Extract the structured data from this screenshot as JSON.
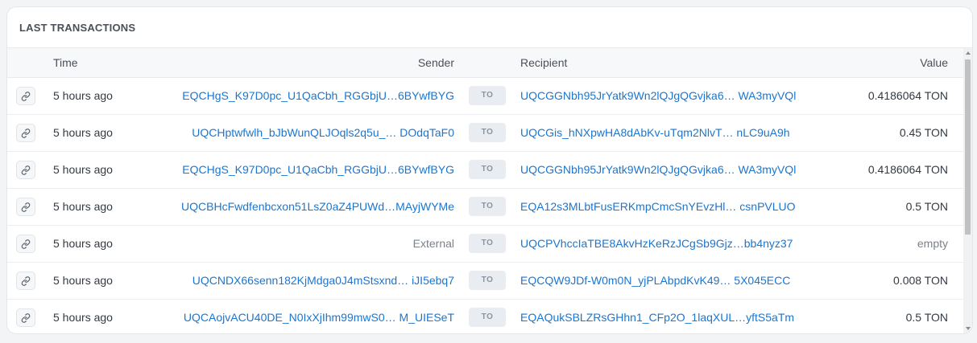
{
  "card": {
    "title": "LAST TRANSACTIONS"
  },
  "columns": {
    "time": "Time",
    "sender": "Sender",
    "recipient": "Recipient",
    "value": "Value"
  },
  "to_label": "TO",
  "icons": {
    "row_link": "link-icon"
  },
  "colors": {
    "link": "#1976d2",
    "muted": "#7b8189",
    "badge_bg": "#e9edf2"
  },
  "rows": [
    {
      "time": "5 hours ago",
      "sender": "EQCHgS_K97D0pc_U1QaCbh_RGGbjU…6BYwfBYG",
      "recipient": "UQCGGNbh95JrYatk9Wn2lQJgQGvjka6… WA3myVQl",
      "value": "0.4186064 TON"
    },
    {
      "time": "5 hours ago",
      "sender": "UQCHptwfwlh_bJbWunQLJOqls2q5u_… DOdqTaF0",
      "recipient": "UQCGis_hNXpwHA8dAbKv-uTqm2NlvT… nLC9uA9h",
      "value": "0.45 TON"
    },
    {
      "time": "5 hours ago",
      "sender": "EQCHgS_K97D0pc_U1QaCbh_RGGbjU…6BYwfBYG",
      "recipient": "UQCGGNbh95JrYatk9Wn2lQJgQGvjka6… WA3myVQl",
      "value": "0.4186064 TON"
    },
    {
      "time": "5 hours ago",
      "sender": "UQCBHcFwdfenbcxon51LsZ0aZ4PUWd…MAyjWYMe",
      "recipient": "EQA12s3MLbtFusERKmpCmcSnYEvzHl… csnPVLUO",
      "value": "0.5 TON"
    },
    {
      "time": "5 hours ago",
      "sender": "External",
      "recipient": "UQCPVhccIaTBE8AkvHzKeRzJCgSb9Gjz…bb4nyz37",
      "value": "empty"
    },
    {
      "time": "5 hours ago",
      "sender": "UQCNDX66senn182KjMdga0J4mStsxnd… iJI5ebq7",
      "recipient": "EQCQW9JDf-W0m0N_yjPLAbpdKvK49… 5X045ECC",
      "value": "0.008 TON"
    },
    {
      "time": "5 hours ago",
      "sender": "UQCAojvACU40DE_N0IxXjIhm99mwS0… M_UIESeT",
      "recipient": "EQAQukSBLZRsGHhn1_CFp2O_1laqXUL…yftS5aTm",
      "value": "0.5 TON"
    }
  ]
}
